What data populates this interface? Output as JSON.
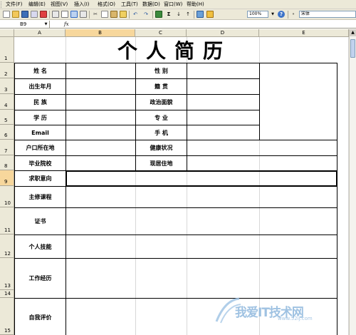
{
  "menu": [
    "文件(F)",
    "编辑(E)",
    "视图(V)",
    "插入(I)",
    "格式(O)",
    "工具(T)",
    "数据(D)",
    "窗口(W)",
    "帮助(H)"
  ],
  "toolbar": {
    "zoom": "100%",
    "font": "宋体"
  },
  "formula_bar": {
    "name_box": "B9",
    "fx": "fx",
    "value": ""
  },
  "columns": [
    "A",
    "B",
    "C",
    "D",
    "E"
  ],
  "rows": [
    "1",
    "2",
    "3",
    "4",
    "5",
    "6",
    "7",
    "8",
    "9",
    "10",
    "11",
    "12",
    "13",
    "14",
    "15"
  ],
  "form": {
    "title": "个人简历",
    "labels": {
      "name": "姓 名",
      "gender": "性 别",
      "birth": "出生年月",
      "native": "籍 贯",
      "ethnic": "民 族",
      "political": "政治面貌",
      "education": "学 历",
      "major": "专 业",
      "email": "Email",
      "phone": "手 机",
      "hukou": "户口所在地",
      "health": "健康状况",
      "school": "毕业院校",
      "residence": "现居住地",
      "intent": "求职意向",
      "courses": "主修课程",
      "certificates": "证书",
      "skills": "个人技能",
      "experience": "工作经历",
      "self_eval": "自我评价"
    }
  },
  "watermark": {
    "text": "我爱IT技术网",
    "url": "www.52ij.com"
  }
}
